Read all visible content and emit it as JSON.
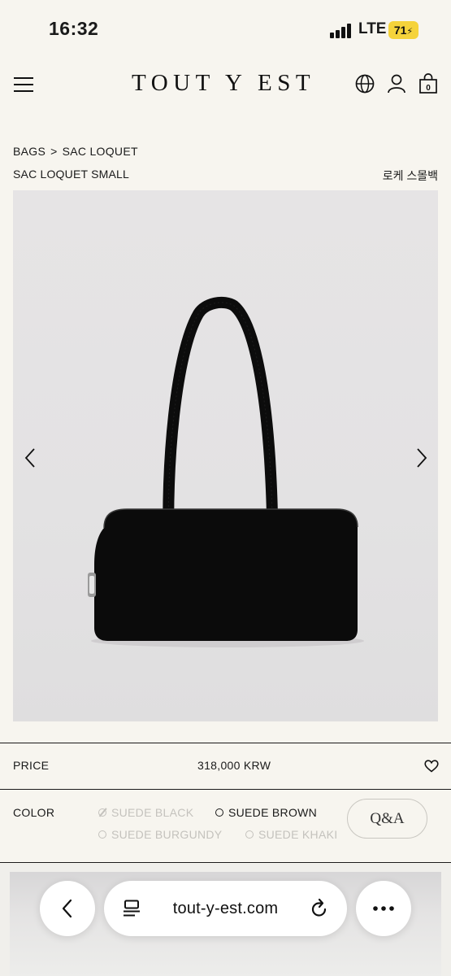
{
  "status_bar": {
    "time": "16:32",
    "network": "LTE",
    "battery": "71"
  },
  "header": {
    "logo": "TOUT Y EST",
    "cart_count": "0"
  },
  "breadcrumb": {
    "category": "BAGS",
    "separator": ">",
    "collection": "SAC LOQUET"
  },
  "product": {
    "name": "SAC LOQUET SMALL",
    "name_kr": "로케 스몰백",
    "price_label": "PRICE",
    "price": "318,000 KRW",
    "color_label": "COLOR",
    "colors": [
      {
        "label": "SUEDE BLACK",
        "available": false
      },
      {
        "label": "SUEDE BROWN",
        "available": true
      },
      {
        "label": "SUEDE BURGUNDY",
        "available": false
      },
      {
        "label": "SUEDE KHAKI",
        "available": false
      }
    ],
    "qa_label": "Q&A"
  },
  "browser": {
    "url": "tout-y-est.com"
  },
  "icons": {
    "menu": "hamburger-icon",
    "globe": "globe-icon",
    "account": "user-icon",
    "cart": "bag-icon",
    "prev": "chevron-left-icon",
    "next": "chevron-right-icon",
    "wishlist": "heart-icon",
    "back": "back-icon",
    "tabs": "tabs-icon",
    "reload": "reload-icon",
    "more": "more-icon"
  },
  "colors": {
    "background": "#f7f5ef",
    "text": "#1a1a1a",
    "battery": "#f5d33b",
    "unavailable": "#c4c2bd"
  }
}
